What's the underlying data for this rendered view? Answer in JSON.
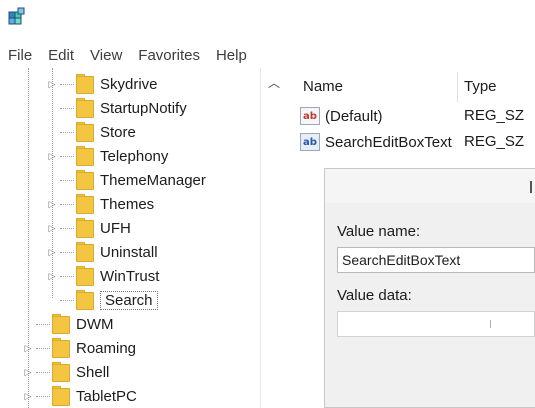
{
  "menu": [
    "File",
    "Edit",
    "View",
    "Favorites",
    "Help"
  ],
  "tree": [
    {
      "label": "Skydrive",
      "expandable": true
    },
    {
      "label": "StartupNotify",
      "expandable": false
    },
    {
      "label": "Store",
      "expandable": false
    },
    {
      "label": "Telephony",
      "expandable": true
    },
    {
      "label": "ThemeManager",
      "expandable": false
    },
    {
      "label": "Themes",
      "expandable": true
    },
    {
      "label": "UFH",
      "expandable": true
    },
    {
      "label": "Uninstall",
      "expandable": true
    },
    {
      "label": "WinTrust",
      "expandable": true
    },
    {
      "label": "Search",
      "expandable": false,
      "selected": true
    },
    {
      "label": "DWM",
      "expandable": false
    },
    {
      "label": "Roaming",
      "expandable": true
    },
    {
      "label": "Shell",
      "expandable": true
    },
    {
      "label": "TabletPC",
      "expandable": true
    }
  ],
  "list": {
    "columns": [
      "Name",
      "Type"
    ],
    "rows": [
      {
        "name": "(Default)",
        "type": "REG_SZ",
        "icon": "string-value-icon"
      },
      {
        "name": "SearchEditBoxText",
        "type": "REG_SZ",
        "icon": "string-value-icon"
      }
    ]
  },
  "dialog": {
    "value_name_label": "Value name:",
    "value_name": "SearchEditBoxText",
    "value_data_label": "Value data:",
    "value_data": ""
  },
  "icons": {
    "ab": "ab"
  }
}
